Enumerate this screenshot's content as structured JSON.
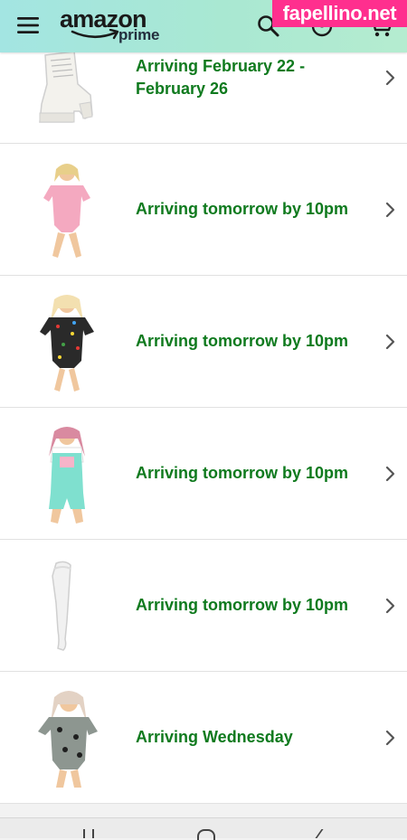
{
  "header": {
    "logo_main": "amazon",
    "logo_sub": "prime",
    "icons": [
      "menu-icon",
      "search-icon",
      "account-icon",
      "cart-icon"
    ]
  },
  "watermark": "fapellino.net",
  "orders": [
    {
      "status": "Arriving February 22 - February 26",
      "item": "white lace-up platform boot"
    },
    {
      "status": "Arriving tomorrow by 10pm",
      "item": "pink short sleeve bodysuit"
    },
    {
      "status": "Arriving tomorrow by 10pm",
      "item": "black printed bodysuit"
    },
    {
      "status": "Arriving tomorrow by 10pm",
      "item": "mint overall shorts"
    },
    {
      "status": "Arriving tomorrow by 10pm",
      "item": "white thigh high stocking"
    },
    {
      "status": "Arriving Wednesday",
      "item": "grey printed bodysuit"
    }
  ],
  "colors": {
    "status_green": "#0f7a1e",
    "header_bg": "#a6e6dc",
    "watermark_bg": "#ff2f8e"
  }
}
